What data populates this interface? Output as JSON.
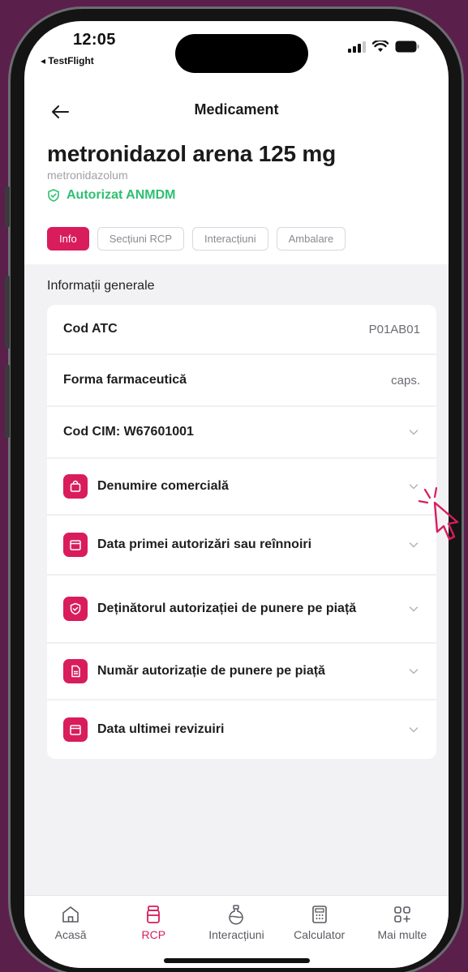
{
  "status_bar": {
    "time": "12:05",
    "back_app": "◂ TestFlight"
  },
  "header": {
    "title": "Medicament"
  },
  "medicine": {
    "name": "metronidazol arena 125 mg",
    "substance": "metronidazolum",
    "authorization": "Autorizat ANMDM"
  },
  "tabs": [
    {
      "label": "Info",
      "active": true
    },
    {
      "label": "Secțiuni RCP",
      "active": false
    },
    {
      "label": "Interacțiuni",
      "active": false
    },
    {
      "label": "Ambalare",
      "active": false
    }
  ],
  "section_title": "Informații generale",
  "info_rows": [
    {
      "label": "Cod ATC",
      "value": "P01AB01"
    },
    {
      "label": "Forma farmaceutică",
      "value": "caps."
    },
    {
      "label": "Cod CIM: W67601001"
    }
  ],
  "expand_rows": [
    {
      "icon": "shopping-bag-icon",
      "label": "Denumire comercială"
    },
    {
      "icon": "calendar-icon",
      "label": "Data primei autorizări sau reînnoiri"
    },
    {
      "icon": "shield-icon",
      "label": "Deținătorul autorizației de punere pe piață"
    },
    {
      "icon": "document-icon",
      "label": "Număr autorizație de punere pe piață"
    },
    {
      "icon": "calendar-icon",
      "label": "Data ultimei revizuiri"
    }
  ],
  "bottom_nav": [
    {
      "label": "Acasă",
      "icon": "home-icon",
      "active": false
    },
    {
      "label": "RCP",
      "icon": "pill-bottle-icon",
      "active": true
    },
    {
      "label": "Interacțiuni",
      "icon": "flask-icon",
      "active": false
    },
    {
      "label": "Calculator",
      "icon": "calculator-icon",
      "active": false
    },
    {
      "label": "Mai multe",
      "icon": "grid-plus-icon",
      "active": false
    }
  ],
  "colors": {
    "accent": "#d91c5c",
    "success": "#2fbf71",
    "background": "#5b1f4b"
  }
}
